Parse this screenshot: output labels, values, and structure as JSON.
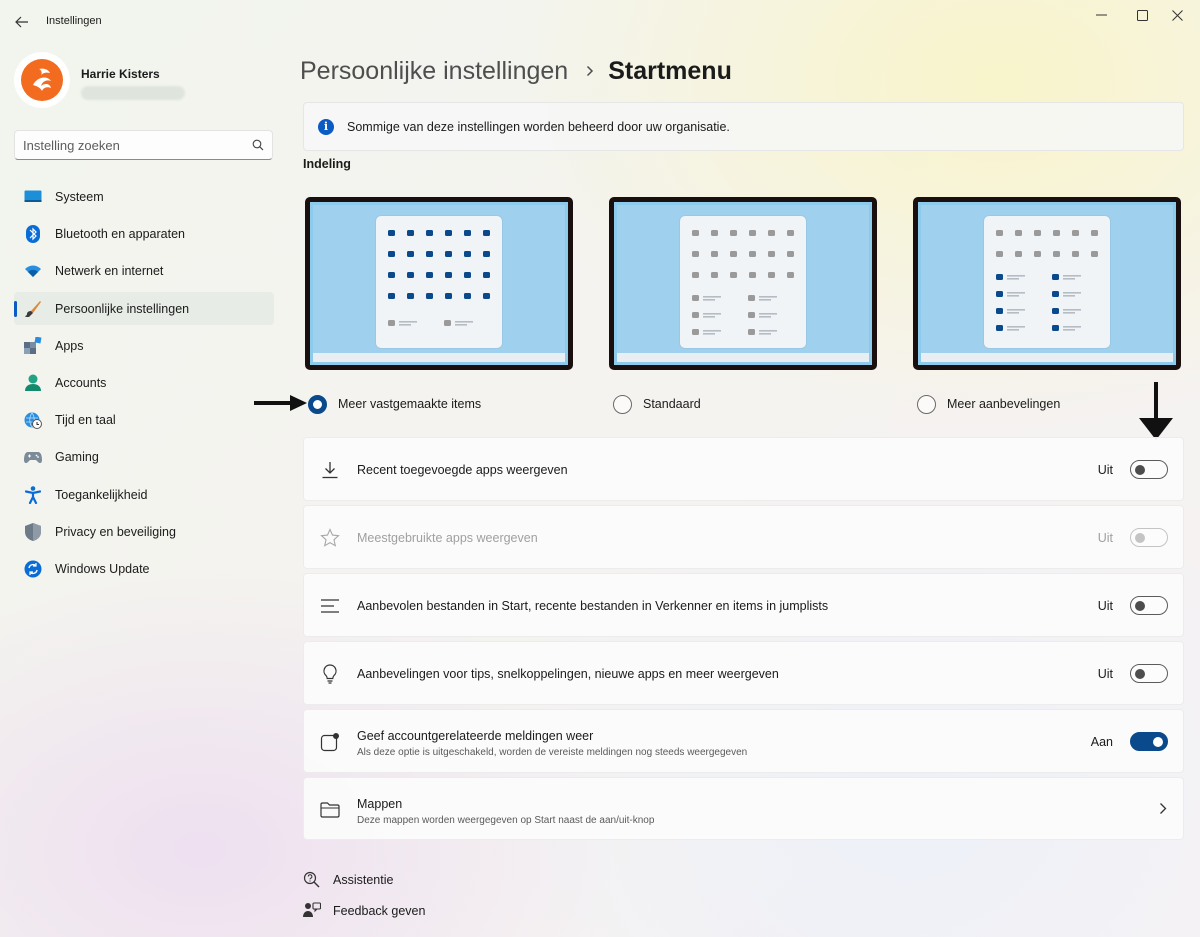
{
  "window": {
    "title": "Instellingen",
    "back_icon": "back-arrow-icon",
    "controls": [
      "minimize-icon",
      "maximize-icon",
      "close-icon"
    ]
  },
  "profile": {
    "name": "Harrie Kisters",
    "avatar_icon": "orange-logo-avatar"
  },
  "search": {
    "placeholder": "Instelling zoeken",
    "icon": "search-icon"
  },
  "sidebar": {
    "items": [
      {
        "label": "Systeem",
        "icon": "system-monitor-icon",
        "active": false
      },
      {
        "label": "Bluetooth en apparaten",
        "icon": "bluetooth-icon",
        "active": false
      },
      {
        "label": "Netwerk en internet",
        "icon": "wifi-icon",
        "active": false
      },
      {
        "label": "Persoonlijke instellingen",
        "icon": "paintbrush-icon",
        "active": true
      },
      {
        "label": "Apps",
        "icon": "apps-icon",
        "active": false
      },
      {
        "label": "Accounts",
        "icon": "person-icon",
        "active": false
      },
      {
        "label": "Tijd en taal",
        "icon": "globe-clock-icon",
        "active": false
      },
      {
        "label": "Gaming",
        "icon": "gamepad-icon",
        "active": false
      },
      {
        "label": "Toegankelijkheid",
        "icon": "accessibility-icon",
        "active": false
      },
      {
        "label": "Privacy en beveiliging",
        "icon": "shield-icon",
        "active": false
      },
      {
        "label": "Windows Update",
        "icon": "update-icon",
        "active": false
      }
    ]
  },
  "header": {
    "parent": "Persoonlijke instellingen",
    "separator_icon": "chevron-right-icon",
    "current": "Startmenu"
  },
  "info_bar": {
    "icon": "info-icon",
    "text": "Sommige van deze instellingen worden beheerd door uw organisatie."
  },
  "layout": {
    "section_title": "Indeling",
    "options": [
      {
        "label": "Meer vastgemaakte items",
        "selected": true
      },
      {
        "label": "Standaard",
        "selected": false
      },
      {
        "label": "Meer aanbevelingen",
        "selected": false
      }
    ]
  },
  "settings": [
    {
      "title": "Recent toegevoegde apps weergeven",
      "icon": "download-icon",
      "state": "Uit",
      "on": false,
      "disabled": false
    },
    {
      "title": "Meestgebruikte apps weergeven",
      "icon": "star-icon",
      "state": "Uit",
      "on": false,
      "disabled": true
    },
    {
      "title": "Aanbevolen bestanden in Start, recente bestanden in Verkenner en items in jumplists",
      "icon": "list-icon",
      "state": "Uit",
      "on": false,
      "disabled": false
    },
    {
      "title": "Aanbevelingen voor tips, snelkoppelingen, nieuwe apps en meer weergeven",
      "icon": "lightbulb-icon",
      "state": "Uit",
      "on": false,
      "disabled": false
    },
    {
      "title": "Geef accountgerelateerde meldingen weer",
      "subtitle": "Als deze optie is uitgeschakeld, worden de vereiste meldingen nog steeds weergegeven",
      "icon": "notification-icon",
      "state": "Aan",
      "on": true,
      "disabled": false
    },
    {
      "title": "Mappen",
      "subtitle": "Deze mappen worden weergegeven op Start naast de aan/uit-knop",
      "icon": "folder-icon",
      "chevron_icon": "chevron-right-icon"
    }
  ],
  "footer": {
    "help": {
      "label": "Assistentie",
      "icon": "help-icon"
    },
    "feedback": {
      "label": "Feedback geven",
      "icon": "feedback-icon"
    }
  },
  "colors": {
    "accent": "#0a4a8c",
    "active_indicator": "#0a5bc4",
    "screen_blue": "#8ccbeb",
    "dot_blue": "#0a4a8c",
    "dot_gray": "#9a9a9a"
  }
}
